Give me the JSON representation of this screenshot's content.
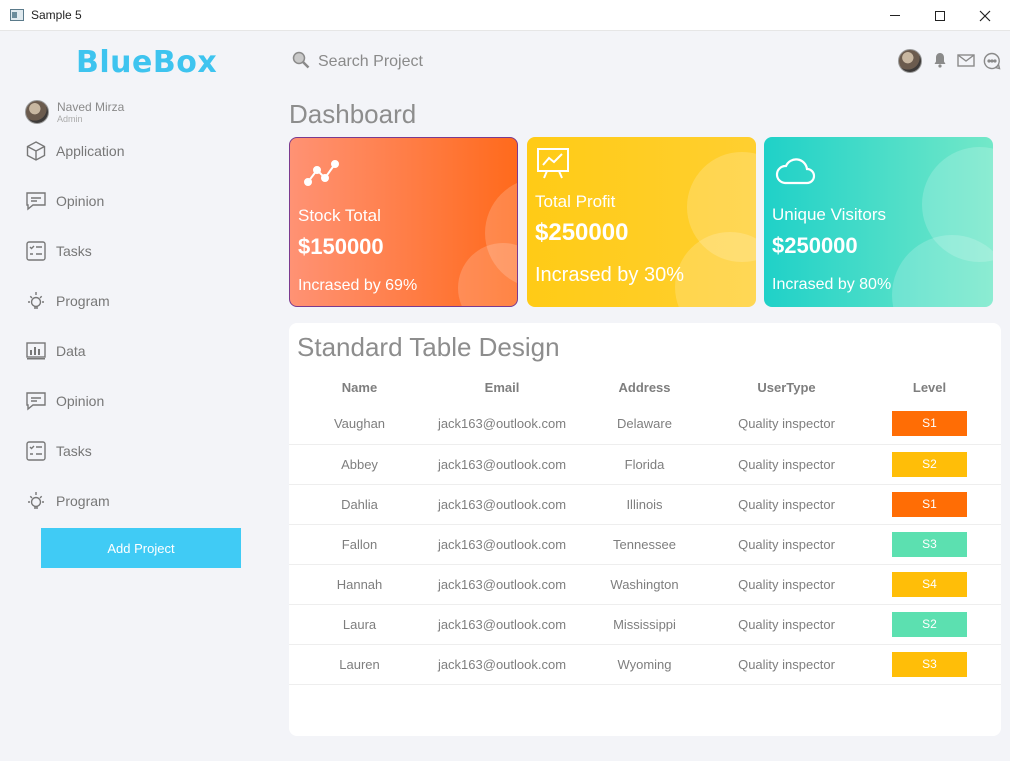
{
  "window": {
    "title": "Sample 5"
  },
  "brand": "BlueBox",
  "user": {
    "name": "Naved Mirza",
    "role": "Admin"
  },
  "nav": [
    {
      "label": "Application",
      "icon": "cube-icon"
    },
    {
      "label": "Opinion",
      "icon": "comment-icon"
    },
    {
      "label": "Tasks",
      "icon": "checklist-icon"
    },
    {
      "label": "Program",
      "icon": "bulb-icon"
    },
    {
      "label": "Data",
      "icon": "bar-chart-icon"
    },
    {
      "label": "Opinion",
      "icon": "comment-icon"
    },
    {
      "label": "Tasks",
      "icon": "checklist-icon"
    },
    {
      "label": "Program",
      "icon": "bulb-icon"
    }
  ],
  "add_project": "Add Project",
  "search": {
    "label": "Search Project"
  },
  "page_title": "Dashboard",
  "cards": [
    {
      "title": "Stock Total",
      "value": "$150000",
      "footer": "Incrased by 69%",
      "icon": "trend-icon"
    },
    {
      "title": "Total Profit",
      "value": "$250000",
      "footer": "Incrased by 30%",
      "icon": "presentation-chart-icon"
    },
    {
      "title": "Unique Visitors",
      "value": "$250000",
      "footer": "Incrased by 80%",
      "icon": "cloud-icon"
    }
  ],
  "table": {
    "title": "Standard Table Design",
    "headers": {
      "name": "Name",
      "email": "Email",
      "address": "Address",
      "usertype": "UserType",
      "level": "Level"
    },
    "rows": [
      {
        "name": "Vaughan",
        "email": "jack163@outlook.com",
        "address": "Delaware",
        "usertype": "Quality inspector",
        "level": "S1",
        "level_color": "#ff6d05"
      },
      {
        "name": "Abbey",
        "email": "jack163@outlook.com",
        "address": "Florida",
        "usertype": "Quality inspector",
        "level": "S2",
        "level_color": "#ffbe08"
      },
      {
        "name": "Dahlia",
        "email": "jack163@outlook.com",
        "address": "Illinois",
        "usertype": "Quality inspector",
        "level": "S1",
        "level_color": "#ff6d05"
      },
      {
        "name": "Fallon",
        "email": "jack163@outlook.com",
        "address": "Tennessee",
        "usertype": "Quality inspector",
        "level": "S3",
        "level_color": "#5ce0b0"
      },
      {
        "name": "Hannah",
        "email": "jack163@outlook.com",
        "address": "Washington",
        "usertype": "Quality inspector",
        "level": "S4",
        "level_color": "#ffbe08"
      },
      {
        "name": "Laura",
        "email": "jack163@outlook.com",
        "address": "Mississippi",
        "usertype": "Quality inspector",
        "level": "S2",
        "level_color": "#5ce0b0"
      },
      {
        "name": "Lauren",
        "email": "jack163@outlook.com",
        "address": "Wyoming",
        "usertype": "Quality inspector",
        "level": "S3",
        "level_color": "#ffbe08"
      }
    ]
  },
  "colors": {
    "brand": "#3ec4ef",
    "button": "#40cbf5",
    "card1": "#ff6a1c",
    "card2": "#ffcb16",
    "card3": "#1fd1c8"
  }
}
